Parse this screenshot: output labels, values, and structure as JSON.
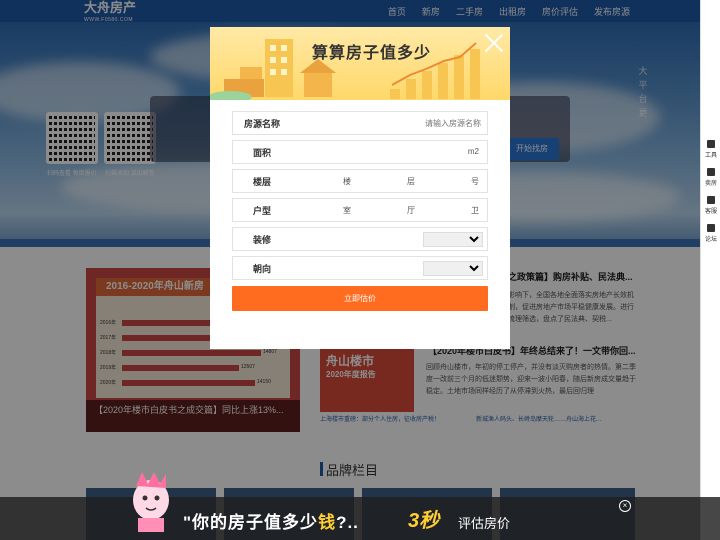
{
  "nav": {
    "logo": "大舟房产",
    "logo_sub": "WWW.F0580.COM",
    "links": [
      "首页",
      "新房",
      "二手房",
      "出租房",
      "房价评估",
      "发布房源"
    ]
  },
  "hero": {
    "qr_labels": [
      "扫码查看 每周报价",
      "扫描添加 谈出解答"
    ],
    "search_button": "开始找房",
    "vertical_text": "大平台更"
  },
  "sidebar": {
    "items": [
      "工具",
      "卖房",
      "客服",
      "论坛"
    ]
  },
  "banner": {
    "heading": "2016-2020年舟山新房",
    "caption": "【2020年楼市白皮书之成交篇】同比上涨13%...",
    "chart_data": {
      "type": "bar",
      "categories": [
        "2016年",
        "2017年",
        "2018年",
        "2019年",
        "2020年"
      ],
      "values": [
        null,
        null,
        14807,
        12507,
        14150
      ],
      "value_labels": [
        "",
        "",
        "14807",
        "12507",
        "14150"
      ]
    }
  },
  "news": {
    "item1_title": "之政策篇】购房补贴、民法典...",
    "item1_body": "影响下，全国各地全面落实房地产长效机制，促进房地产市场平稳健康发展。进行梳理筛选，盘点了民法典、契税...",
    "item2_title": "【2020年楼市白皮书】年终总结来了！一文带你回...",
    "item2_body": "回顾舟山楼市，年初的停工停产，并没有淡灭购房者的热情。第二季度一改前三个月的低迷颓势，迎来一波小阳春，随后新房成交量趋于稳定。土地市场同样经历了从停滞到火热，最后回归理",
    "thumb_title": "舟山楼市",
    "thumb_sub": "2020年度报告",
    "links": [
      "上海楼市重磅：部分个人住房，征收房产税！",
      "新城渔人码头、长峙岛摩天轮……舟山海上花..."
    ],
    "brand_title": "品牌栏目"
  },
  "modal": {
    "title": "算算房子值多少",
    "fields": {
      "name_label": "房源名称",
      "name_placeholder": "请输入房源名称",
      "area_label": "面积",
      "area_unit": "m2",
      "floor_label": "楼层",
      "floor_parts": [
        "楼",
        "层",
        "号"
      ],
      "layout_label": "户型",
      "layout_parts": [
        "室",
        "厅",
        "卫"
      ],
      "decor_label": "装修",
      "decor_value": "",
      "orient_label": "朝向",
      "orient_value": ""
    },
    "submit_label": "立即估价"
  },
  "promo": {
    "text_a": "\"你的房子值多少",
    "text_hl": "钱",
    "text_b": "?..",
    "seconds": "3秒",
    "eval": "评估房价",
    "close": "×"
  }
}
